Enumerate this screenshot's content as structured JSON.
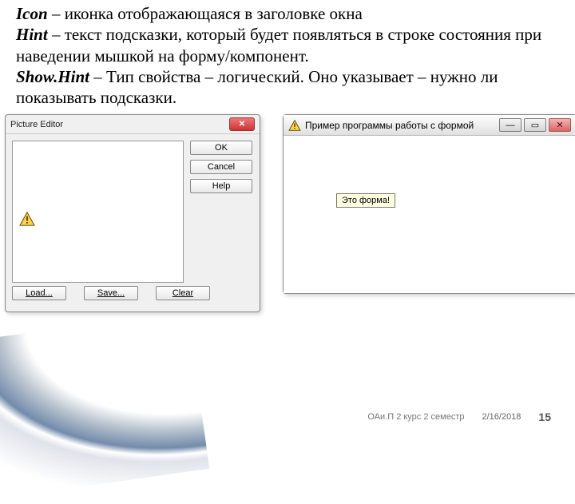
{
  "definitions": {
    "icon_term": "Icon",
    "icon_desc": " – иконка отображающаяся в заголовке окна",
    "hint_term": "Hint",
    "hint_desc": " – текст подсказки, который будет появляться в строке состояния при наведении мышкой на форму/компонент.",
    "showhint_term": "Show.Hint",
    "showhint_desc": " – Тип свойства – логический. Оно указывает – нужно ли показывать подсказки."
  },
  "picture_editor": {
    "title": "Picture Editor",
    "buttons": {
      "ok": "OK",
      "cancel": "Cancel",
      "help": "Help"
    },
    "bottom": {
      "load": "Load...",
      "save": "Save...",
      "clear": "Clear"
    }
  },
  "form_window": {
    "title": "Пример программы работы с формой",
    "tooltip": "Это форма!",
    "win_min": "—",
    "win_max": "▭",
    "win_close": "✕"
  },
  "footer": {
    "course": "ОАи.П 2 курс 2 семестр",
    "date": "2/16/2018",
    "page": "15"
  }
}
